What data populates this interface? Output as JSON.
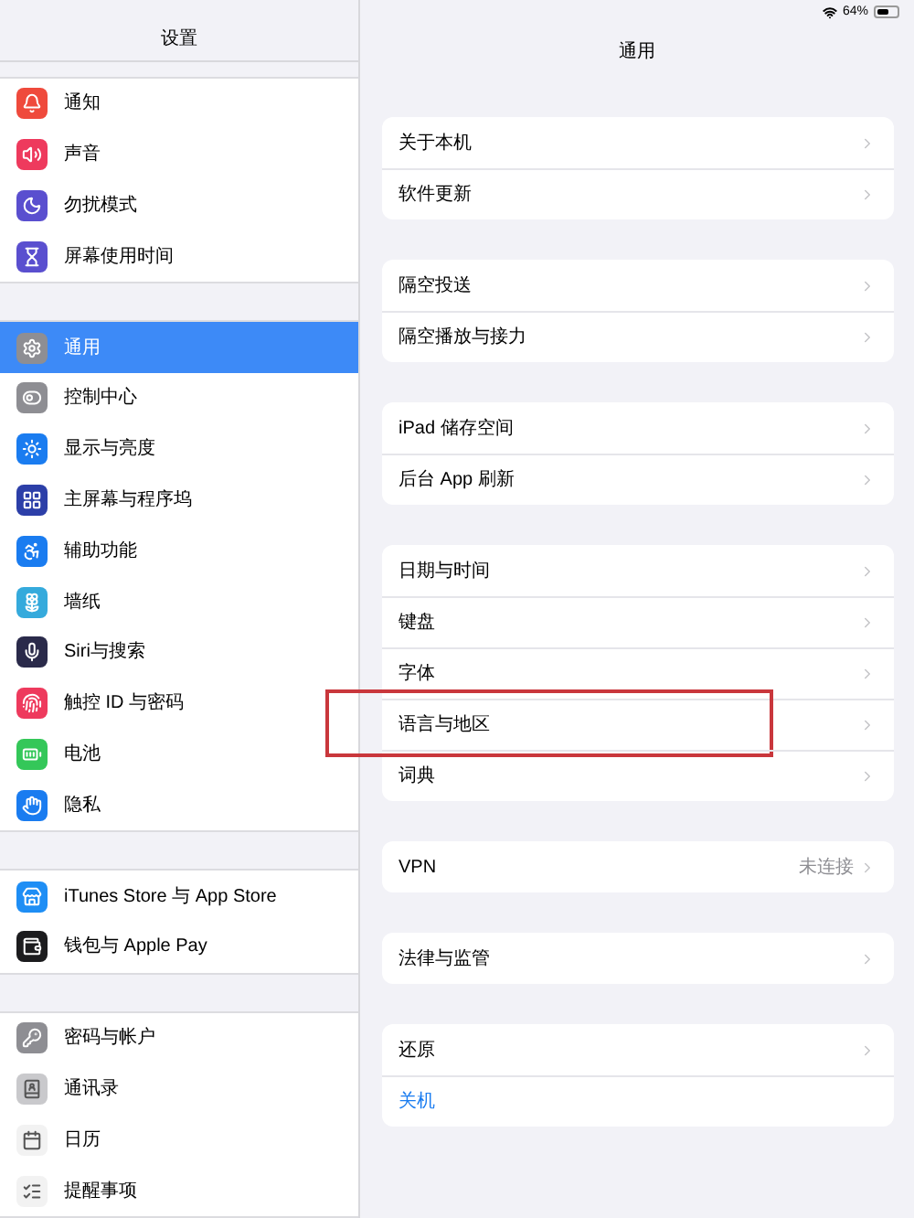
{
  "status_bar": {
    "battery": "64%"
  },
  "sidebar": {
    "title": "设置",
    "groups": [
      [
        {
          "label": "通知",
          "color": "#ef4a3c",
          "selected": false
        },
        {
          "label": "声音",
          "color": "#ee3a5d",
          "selected": false
        },
        {
          "label": "勿扰模式",
          "color": "#5a4fcf",
          "selected": false
        },
        {
          "label": "屏幕使用时间",
          "color": "#5a4fcf",
          "selected": false
        }
      ],
      [
        {
          "label": "通用",
          "color": "#8e8e93",
          "selected": true
        },
        {
          "label": "控制中心",
          "color": "#8e8e93",
          "selected": false
        },
        {
          "label": "显示与亮度",
          "color": "#1a7cf0",
          "selected": false
        },
        {
          "label": "主屏幕与程序坞",
          "color": "#2c3fa8",
          "selected": false
        },
        {
          "label": "辅助功能",
          "color": "#1a7cf0",
          "selected": false
        },
        {
          "label": "墙纸",
          "color": "#35aadc",
          "selected": false
        },
        {
          "label": "Siri与搜索",
          "color": "#2a2a4a",
          "selected": false
        },
        {
          "label": "触控 ID 与密码",
          "color": "#ee3a5d",
          "selected": false
        },
        {
          "label": "电池",
          "color": "#34c759",
          "selected": false
        },
        {
          "label": "隐私",
          "color": "#1a7cf0",
          "selected": false
        }
      ],
      [
        {
          "label": "iTunes Store 与 App Store",
          "color": "#1e8ef5",
          "selected": false
        },
        {
          "label": "钱包与 Apple Pay",
          "color": "#1c1c1e",
          "selected": false
        }
      ],
      [
        {
          "label": "密码与帐户",
          "color": "#8e8e93",
          "selected": false
        },
        {
          "label": "通讯录",
          "color": "#c9c9cc",
          "selected": false
        },
        {
          "label": "日历",
          "color": "#f2f2f2",
          "selected": false
        },
        {
          "label": "提醒事项",
          "color": "#f2f2f2",
          "selected": false
        }
      ]
    ]
  },
  "detail": {
    "title": "通用",
    "groups": [
      [
        {
          "kind": "link",
          "label": "关于本机",
          "annotated": false
        },
        {
          "kind": "link",
          "label": "软件更新",
          "annotated": false
        }
      ],
      [
        {
          "kind": "link",
          "label": "隔空投送",
          "annotated": false
        },
        {
          "kind": "link",
          "label": "隔空播放与接力",
          "annotated": false
        }
      ],
      [
        {
          "kind": "link",
          "label": "iPad 储存空间",
          "annotated": false
        },
        {
          "kind": "link",
          "label": "后台 App 刷新",
          "annotated": false
        }
      ],
      [
        {
          "kind": "link",
          "label": "日期与时间",
          "annotated": false
        },
        {
          "kind": "link",
          "label": "键盘",
          "annotated": false
        },
        {
          "kind": "link",
          "label": "字体",
          "annotated": false
        },
        {
          "kind": "link",
          "label": "语言与地区",
          "annotated": true
        },
        {
          "kind": "link",
          "label": "词典",
          "annotated": false
        }
      ],
      [
        {
          "kind": "link",
          "label": "VPN",
          "value": "未连接",
          "annotated": false
        }
      ],
      [
        {
          "kind": "link",
          "label": "法律与监管",
          "annotated": false
        }
      ],
      [
        {
          "kind": "link",
          "label": "还原",
          "annotated": false
        },
        {
          "kind": "action",
          "label": "关机",
          "annotated": false
        }
      ]
    ]
  }
}
